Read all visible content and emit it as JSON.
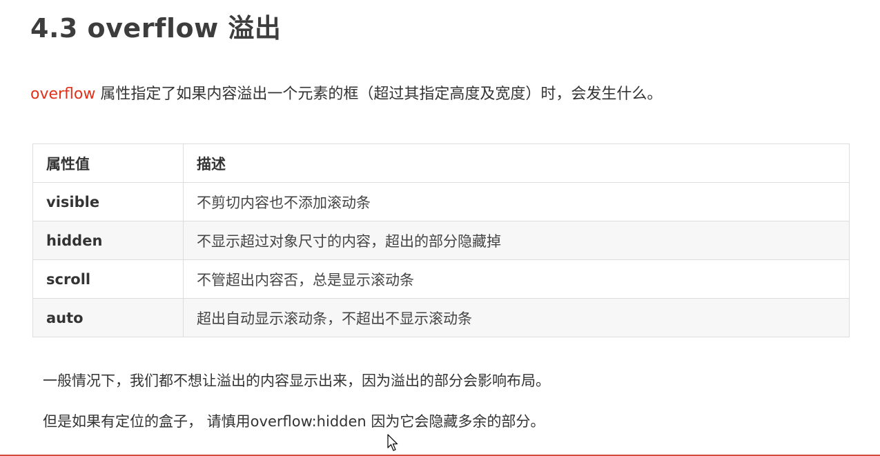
{
  "title": "4.3 overflow 溢出",
  "intro": {
    "keyword": "overflow",
    "text": " 属性指定了如果内容溢出一个元素的框（超过其指定高度及宽度）时，会发生什么。"
  },
  "table": {
    "headers": [
      "属性值",
      "描述"
    ],
    "rows": [
      {
        "value": "visible",
        "desc": "不剪切内容也不添加滚动条"
      },
      {
        "value": "hidden",
        "desc": "不显示超过对象尺寸的内容，超出的部分隐藏掉"
      },
      {
        "value": "scroll",
        "desc": "不管超出内容否，总是显示滚动条"
      },
      {
        "value": "auto",
        "desc": "超出自动显示滚动条，不超出不显示滚动条"
      }
    ]
  },
  "notes": [
    "一般情况下，我们都不想让溢出的内容显示出来，因为溢出的部分会影响布局。",
    "但是如果有定位的盒子， 请慎用overflow:hidden 因为它会隐藏多余的部分。"
  ],
  "colors": {
    "keyword": "#e0311a",
    "border": "#dcdcdc",
    "stripe": "#f7f7f7"
  }
}
